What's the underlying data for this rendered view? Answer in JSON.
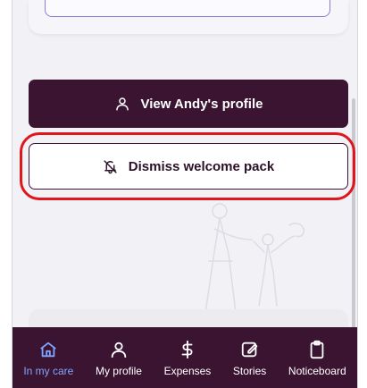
{
  "actions": {
    "view_profile_label": "View Andy's profile",
    "dismiss_label": "Dismiss welcome pack"
  },
  "nav": {
    "items": [
      {
        "label": "In my care",
        "icon": "home-icon",
        "active": true
      },
      {
        "label": "My profile",
        "icon": "person-icon",
        "active": false
      },
      {
        "label": "Expenses",
        "icon": "dollar-icon",
        "active": false
      },
      {
        "label": "Stories",
        "icon": "edit-icon",
        "active": false
      },
      {
        "label": "Noticeboard",
        "icon": "clipboard-icon",
        "active": false
      }
    ]
  },
  "colors": {
    "brand": "#3b1432",
    "active_nav": "#7fa6ff",
    "highlight": "#e0161d"
  }
}
